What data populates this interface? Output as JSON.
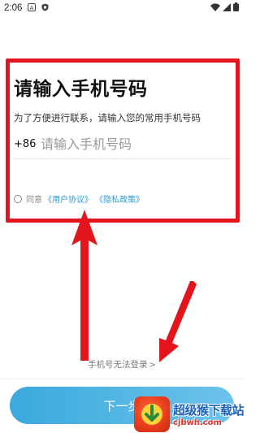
{
  "status_bar": {
    "time": "2:06",
    "icons": [
      "font-a-icon",
      "shield-icon",
      "wifi-icon",
      "signal-icon",
      "battery-icon"
    ]
  },
  "login": {
    "title": "请输入手机号码",
    "subtitle": "为了方便进行联系，请输入您的常用手机号码",
    "country_code": "+86",
    "phone_placeholder": "请输入手机号码",
    "phone_value": ""
  },
  "agreement": {
    "prefix": "同意",
    "user_agreement": "《用户协议》",
    "privacy_policy": "《隐私政策》",
    "checked": false
  },
  "footer": {
    "cannot_login": "手机号无法登录",
    "next_button": "下一步"
  },
  "watermark": {
    "title": "超级猴下载站",
    "url": "cjbwh.com"
  },
  "colors": {
    "accent": "#3aa9dd",
    "highlight": "#e4141c",
    "link": "#2a9bd6"
  }
}
